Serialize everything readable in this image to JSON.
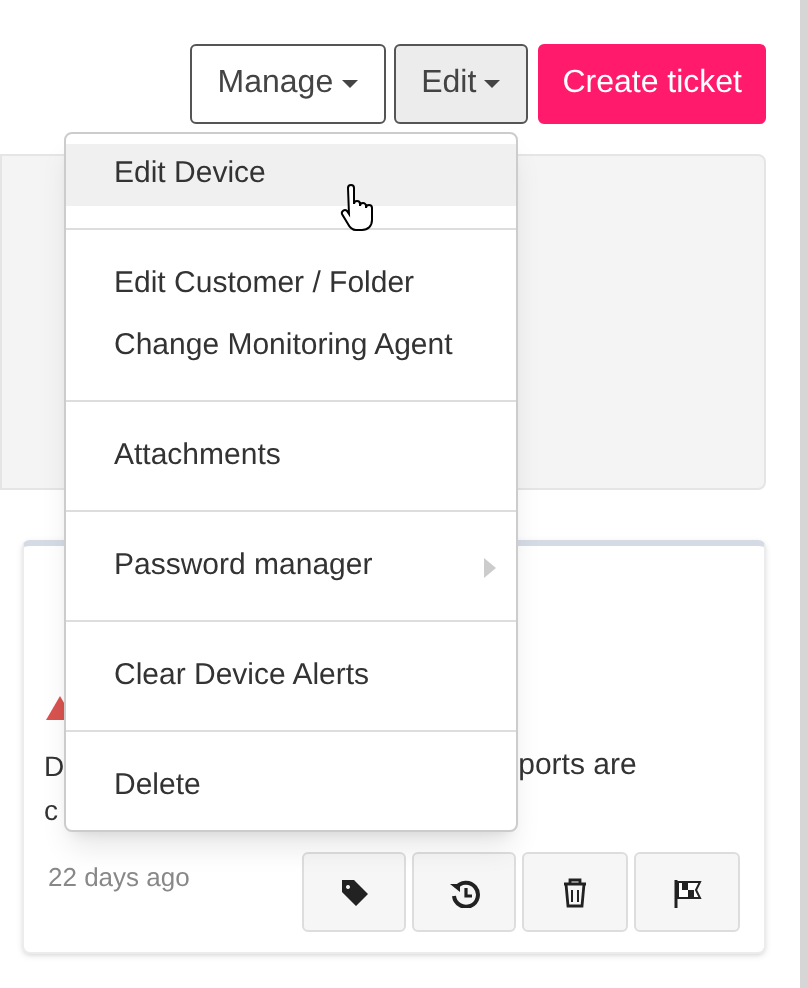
{
  "toolbar": {
    "buttons": [
      {
        "label": "Manage",
        "kind": "dropdown",
        "pressed": false
      },
      {
        "label": "Edit",
        "kind": "dropdown",
        "pressed": true
      },
      {
        "label": "Create ticket",
        "kind": "primary"
      }
    ]
  },
  "edit_menu": {
    "groups": [
      [
        {
          "label": "Edit Device",
          "hovered": true,
          "submenu": false
        }
      ],
      [
        {
          "label": "Edit Customer / Folder",
          "hovered": false,
          "submenu": false
        },
        {
          "label": "Change Monitoring Agent",
          "hovered": false,
          "submenu": false
        }
      ],
      [
        {
          "label": "Attachments",
          "hovered": false,
          "submenu": false
        }
      ],
      [
        {
          "label": "Password manager",
          "hovered": false,
          "submenu": true
        }
      ],
      [
        {
          "label": "Clear Device Alerts",
          "hovered": false,
          "submenu": false
        }
      ],
      [
        {
          "label": "Delete",
          "hovered": false,
          "submenu": false
        }
      ]
    ]
  },
  "alert_card": {
    "message_lines": [
      [
        "D",
        "ports are"
      ],
      [
        "c"
      ]
    ],
    "time": "22 days ago",
    "actions": [
      {
        "kind": "tag"
      },
      {
        "kind": "history"
      },
      {
        "kind": "trash"
      },
      {
        "kind": "flag"
      }
    ]
  }
}
